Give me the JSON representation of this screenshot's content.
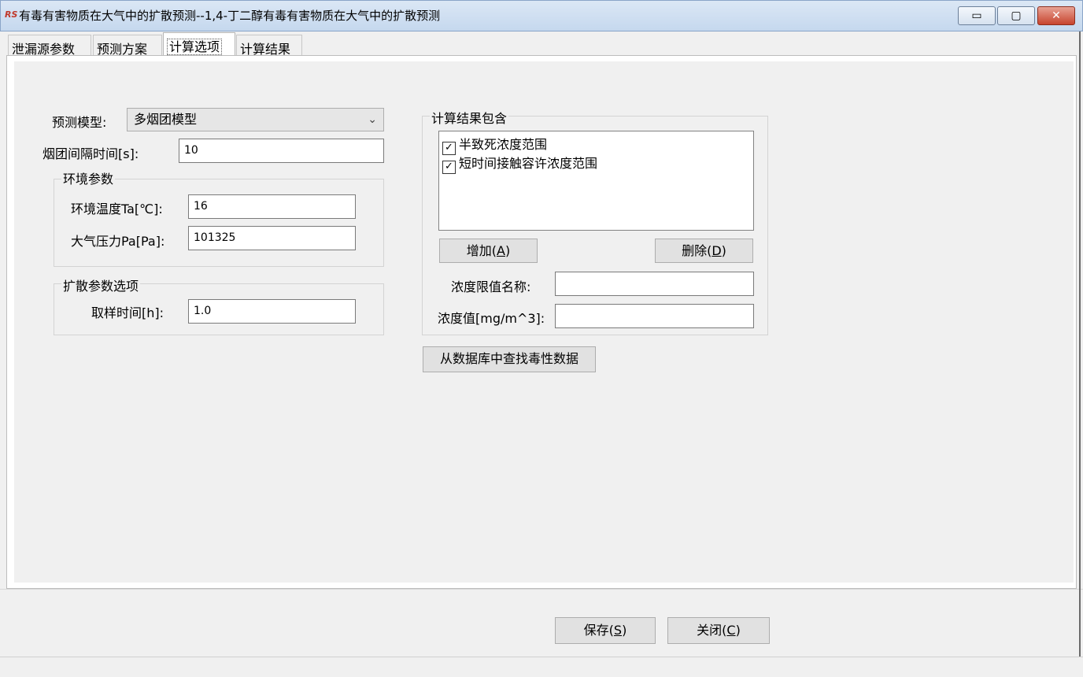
{
  "window": {
    "title": "有毒有害物质在大气中的扩散预测--1,4-丁二醇有毒有害物质在大气中的扩散预测",
    "icon_text": "RS",
    "controls": {
      "minimize": "▭",
      "maximize": "▢",
      "close": "✕"
    }
  },
  "tabs": [
    {
      "label": "泄漏源参数"
    },
    {
      "label": "预测方案"
    },
    {
      "label": "计算选项"
    },
    {
      "label": "计算结果"
    }
  ],
  "form": {
    "model_label": "预测模型:",
    "model_value": "多烟团模型",
    "interval_label": "烟团间隔时间[s]:",
    "interval_value": "10",
    "env_group": "环境参数",
    "temp_label": "环境温度Ta[℃]:",
    "temp_value": "16",
    "pressure_label": "大气压力Pa[Pa]:",
    "pressure_value": "101325",
    "diffusion_group": "扩散参数选项",
    "sample_label": "取样时间[h]:",
    "sample_value": "1.0"
  },
  "results": {
    "group": "计算结果包含",
    "items": [
      {
        "label": "半致死浓度范围",
        "checked": true
      },
      {
        "label": "短时间接触容许浓度范围",
        "checked": true
      }
    ],
    "add_button": "增加(",
    "add_key": "A",
    "delete_button": "删除(",
    "delete_key": "D",
    "limit_name_label": "浓度限值名称:",
    "limit_name_value": "",
    "conc_label": "浓度值[mg/m^3]:",
    "conc_value": "",
    "lookup_button": "从数据库中查找毒性数据"
  },
  "footer": {
    "save_button": "保存(",
    "save_key": "S",
    "close_button": "关闭(",
    "close_key": "C",
    "paren_close": ")"
  }
}
